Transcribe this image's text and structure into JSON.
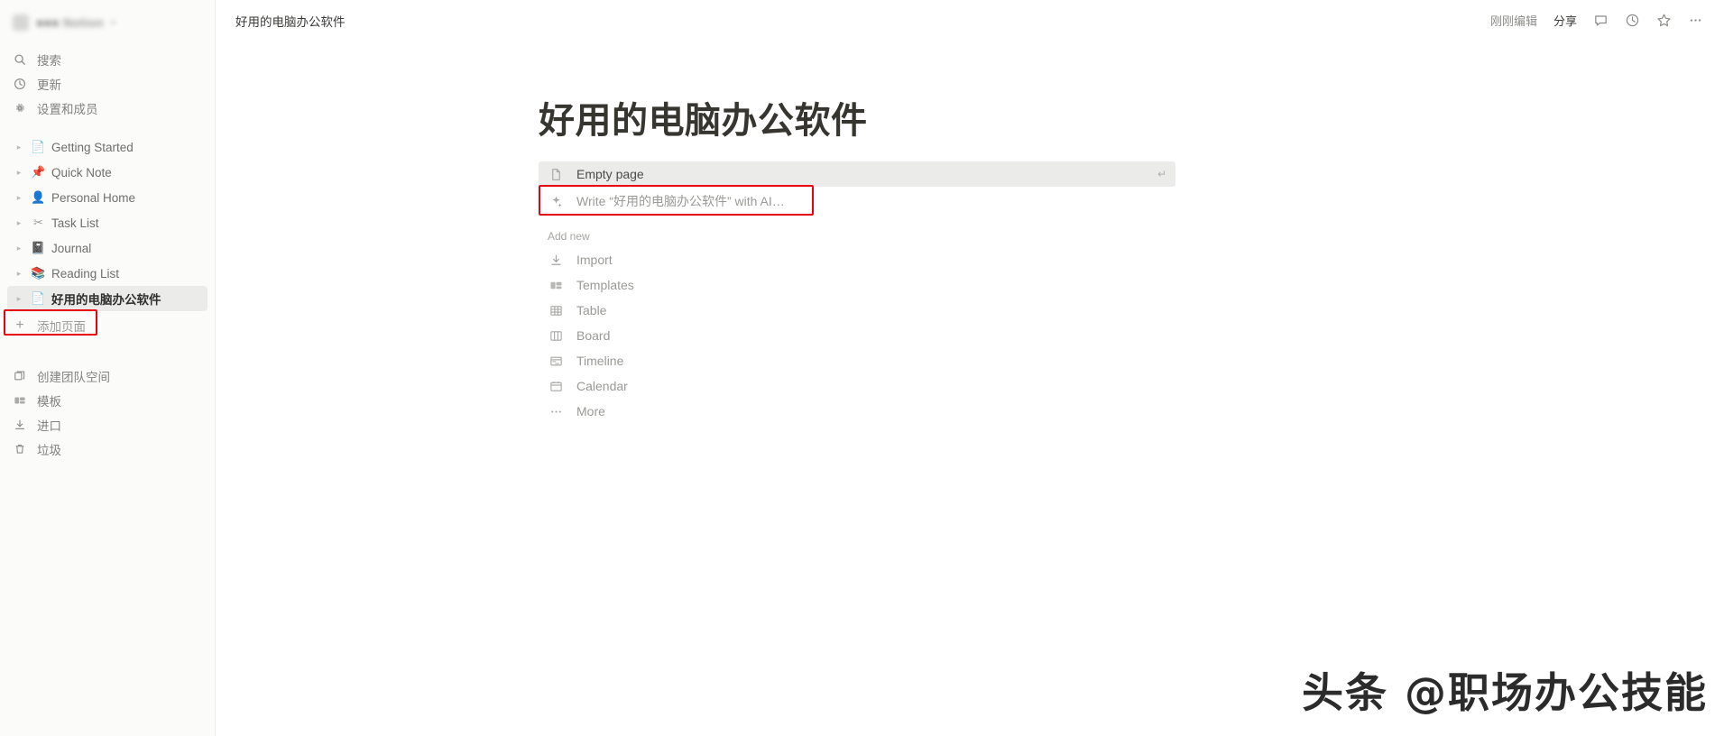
{
  "sidebar": {
    "workspace": {
      "name": "■■■ Notion",
      "redacted": true,
      "chevron": "▾"
    },
    "nav": [
      {
        "icon": "search-icon",
        "label": "搜索"
      },
      {
        "icon": "clock-update-icon",
        "label": "更新"
      },
      {
        "icon": "gear-icon",
        "label": "设置和成员"
      }
    ],
    "pages": [
      {
        "icon": "📄",
        "label": "Getting Started",
        "selected": false
      },
      {
        "icon": "📌",
        "label": "Quick Note",
        "selected": false
      },
      {
        "icon": "👤",
        "label": "Personal Home",
        "selected": false
      },
      {
        "icon": "✂",
        "label": "Task List",
        "selected": false
      },
      {
        "icon": "📓",
        "label": "Journal",
        "selected": false
      },
      {
        "icon": "📚",
        "label": "Reading List",
        "selected": false
      },
      {
        "icon": "📄",
        "label": "好用的电脑办公软件",
        "selected": true
      }
    ],
    "add_page": {
      "icon": "plus-icon",
      "label": "添加页面"
    },
    "footer": [
      {
        "icon": "teamspace-icon",
        "label": "创建团队空间"
      },
      {
        "icon": "templates-icon",
        "label": "模板"
      },
      {
        "icon": "import-icon",
        "label": "进口"
      },
      {
        "icon": "trash-icon",
        "label": "垃圾"
      }
    ]
  },
  "topbar": {
    "breadcrumb": "好用的电脑办公软件",
    "edited_status": "刚刚编辑",
    "share_label": "分享",
    "icons": [
      {
        "name": "comment-icon",
        "glyph": "💬"
      },
      {
        "name": "history-clock-icon",
        "glyph": "◷"
      },
      {
        "name": "star-icon",
        "glyph": "☆"
      },
      {
        "name": "more-menu-icon",
        "glyph": "•••"
      }
    ]
  },
  "main": {
    "page_title": "好用的电脑办公软件",
    "empty_page": {
      "icon": "page-icon",
      "label": "Empty page",
      "shortcut": "↵",
      "highlighted": true
    },
    "ai_write": {
      "icon": "ai-sparkle-icon",
      "label": "Write “好用的电脑办公软件” with AI…",
      "annotated": true
    },
    "add_new_label": "Add new",
    "add_new_items": [
      {
        "icon": "import-download-icon",
        "label": "Import"
      },
      {
        "icon": "templates-icon",
        "label": "Templates"
      },
      {
        "icon": "table-icon",
        "label": "Table"
      },
      {
        "icon": "board-icon",
        "label": "Board"
      },
      {
        "icon": "timeline-icon",
        "label": "Timeline"
      },
      {
        "icon": "calendar-icon",
        "label": "Calendar"
      },
      {
        "icon": "more-dots-icon",
        "label": "More"
      }
    ]
  },
  "watermark": {
    "text": "头条 @职场办公技能"
  },
  "colors": {
    "annotation_red": "#e60012",
    "accent_ai_purple": "#a08ad4",
    "sidebar_bg": "#fbfbfa",
    "highlight_bg": "#ebebea"
  }
}
